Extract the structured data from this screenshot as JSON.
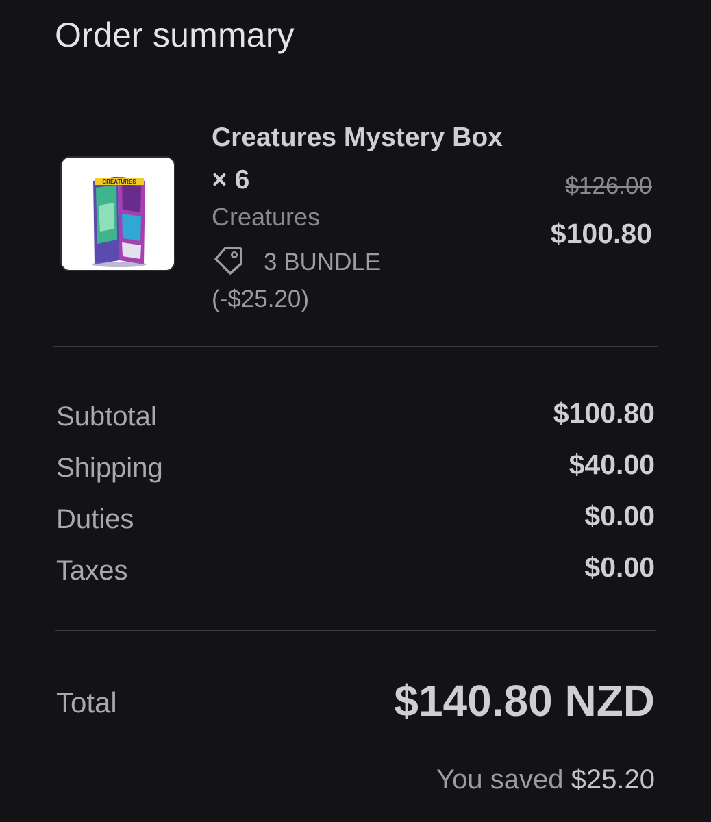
{
  "header": {
    "title": "Order summary"
  },
  "line_item": {
    "name": "Creatures Mystery Box × 6",
    "vendor": "Creatures",
    "discount_label": "3 BUNDLE (-$25.20)",
    "original_price": "$126.00",
    "price": "$100.80",
    "image": {
      "alt": "Creatures Mystery Box product image",
      "logo_text": "CREATURES"
    },
    "icons": {
      "discount": "tag-icon"
    }
  },
  "costs": {
    "subtotal": {
      "label": "Subtotal",
      "value": "$100.80"
    },
    "shipping": {
      "label": "Shipping",
      "value": "$40.00"
    },
    "duties": {
      "label": "Duties",
      "value": "$0.00"
    },
    "taxes": {
      "label": "Taxes",
      "value": "$0.00"
    }
  },
  "total": {
    "label": "Total",
    "value": "$140.80 NZD"
  },
  "savings": {
    "label": "You saved",
    "value": "$25.20"
  },
  "colors": {
    "background": "#131315",
    "text": "#cfcfd1",
    "muted": "#8a8a8e",
    "divider": "#3a3a3d"
  }
}
